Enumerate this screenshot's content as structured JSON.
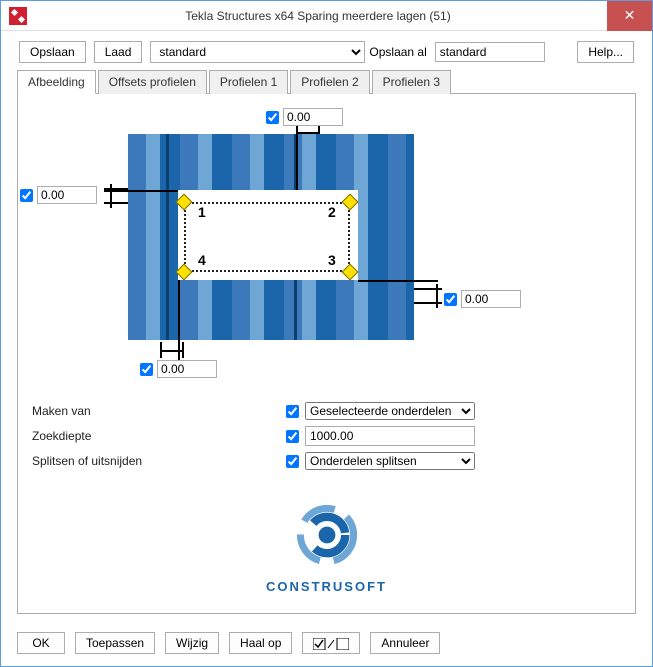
{
  "window": {
    "title": "Tekla Structures x64  Sparing meerdere lagen (51)",
    "close_label": "✕"
  },
  "toolbar": {
    "save": "Opslaan",
    "load": "Laad",
    "preset_options": [
      "standard"
    ],
    "preset_selected": "standard",
    "save_as": "Opslaan al",
    "save_as_value": "standard",
    "help": "Help..."
  },
  "tabs": [
    {
      "id": "afbeelding",
      "label": "Afbeelding",
      "active": true
    },
    {
      "id": "offsets",
      "label": "Offsets profielen",
      "active": false
    },
    {
      "id": "prof1",
      "label": "Profielen 1",
      "active": false
    },
    {
      "id": "prof2",
      "label": "Profielen 2",
      "active": false
    },
    {
      "id": "prof3",
      "label": "Profielen 3",
      "active": false
    }
  ],
  "diagram": {
    "top": {
      "checked": true,
      "value": "0.00"
    },
    "left": {
      "checked": true,
      "value": "0.00"
    },
    "right": {
      "checked": true,
      "value": "0.00"
    },
    "bottom": {
      "checked": true,
      "value": "0.00"
    },
    "points": [
      "1",
      "2",
      "3",
      "4"
    ]
  },
  "fields": {
    "make_from": {
      "label": "Maken van",
      "checked": true,
      "value": "Geselecteerde onderdelen"
    },
    "search_depth": {
      "label": "Zoekdiepte",
      "checked": true,
      "value": "1000.00"
    },
    "split_cut": {
      "label": "Splitsen of uitsnijden",
      "checked": true,
      "value": "Onderdelen splitsen"
    }
  },
  "logo": {
    "text": "CONSTRUSOFT"
  },
  "bottombar": {
    "ok": "OK",
    "apply": "Toepassen",
    "modify": "Wijzig",
    "fetch": "Haal op",
    "toggle_tip": "☑ / ☐",
    "cancel": "Annuleer"
  }
}
